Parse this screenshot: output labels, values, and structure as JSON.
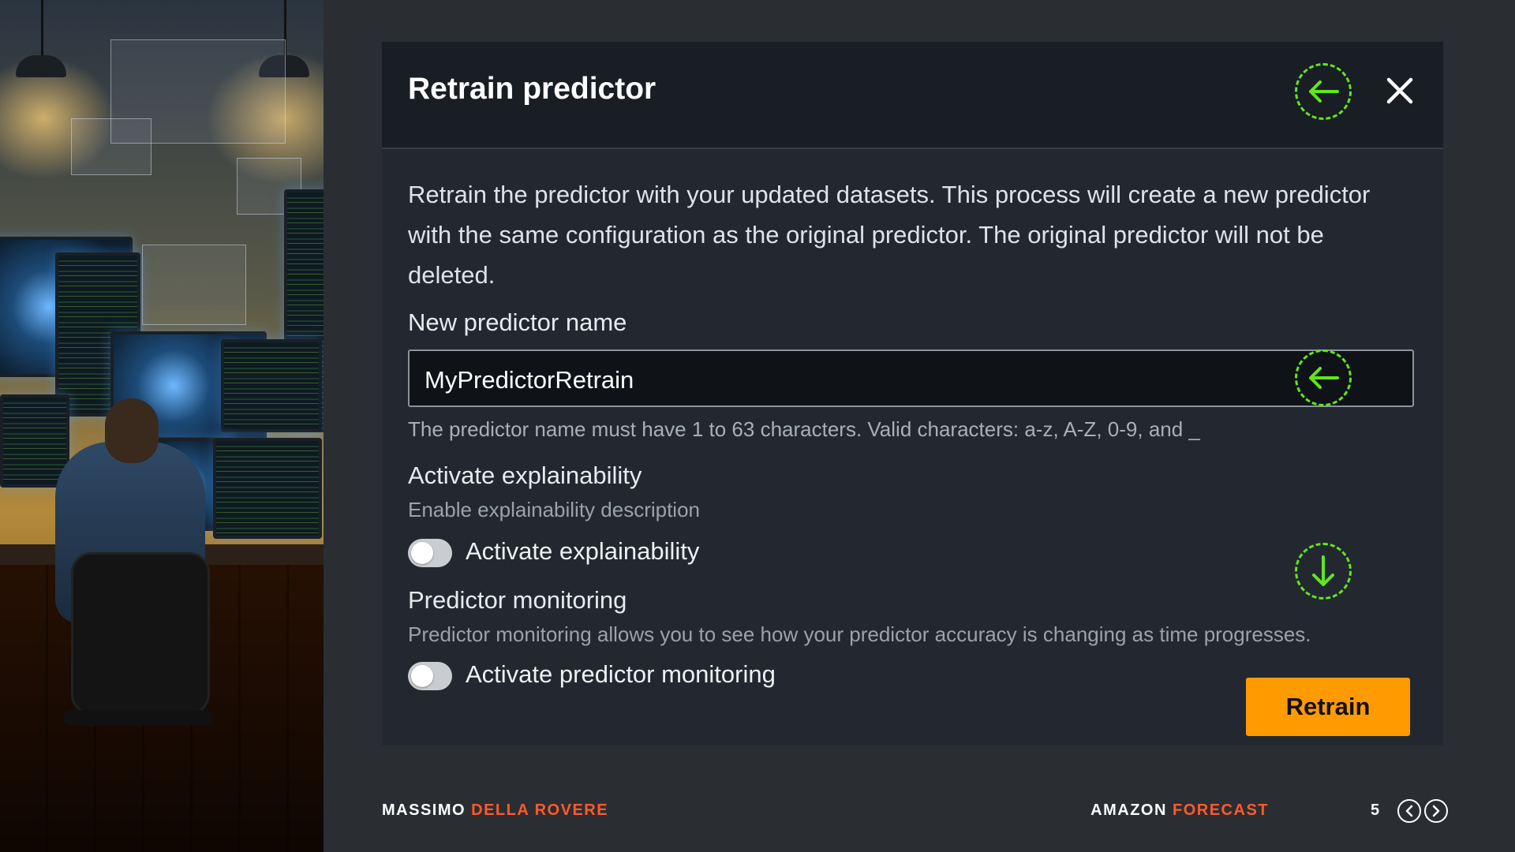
{
  "dialog": {
    "title": "Retrain predictor",
    "description": "Retrain the predictor with your updated datasets. This process will create a new predictor with the same configuration as the original predictor. The original predictor will not be deleted.",
    "name_field": {
      "label": "New predictor name",
      "value": "MyPredictorRetrain",
      "constraint": "The predictor name must have 1 to 63 characters. Valid characters: a-z, A-Z, 0-9, and _"
    },
    "explainability": {
      "heading": "Activate explainability",
      "description": "Enable explainability description",
      "toggle_label": "Activate explainability",
      "enabled": false
    },
    "monitoring": {
      "heading": "Predictor monitoring",
      "description": "Predictor monitoring allows you to see how your predictor accuracy is changing as time progresses.",
      "toggle_label": "Activate predictor monitoring",
      "enabled": false
    },
    "retrain_label": "Retrain",
    "icons": {
      "close": "close-icon",
      "title_hint": "arrow-left-icon",
      "input_hint": "arrow-left-icon",
      "toggle_hint": "arrow-down-icon"
    }
  },
  "footer": {
    "author_first": "MASSIMO",
    "author_last": "DELLA ROVERE",
    "course_first": "AMAZON",
    "course_last": "FORECAST",
    "page": "5"
  },
  "colors": {
    "accent": "#ff5a2a",
    "button": "#ff9b00",
    "hint": "#62e61c",
    "dialog_bg": "#232830",
    "header_bg": "#191d24",
    "page_bg": "#2a2e33"
  }
}
